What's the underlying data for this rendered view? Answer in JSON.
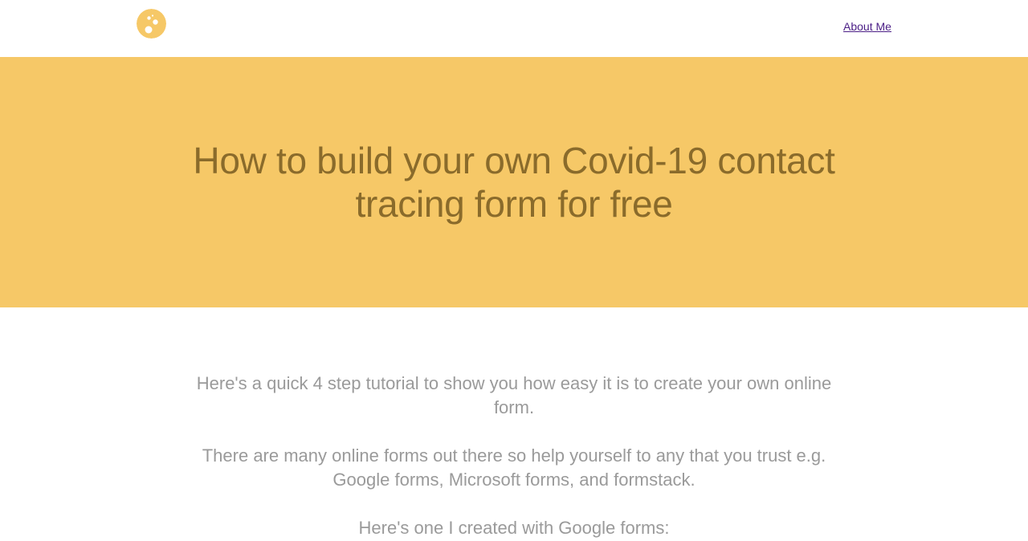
{
  "header": {
    "logo_name": "bubbles-logo",
    "nav": {
      "about_label": "About Me"
    }
  },
  "hero": {
    "title": "How to build your own Covid-19 contact tracing form for free",
    "background_color": "#f6c867",
    "title_color": "#8a6b2b"
  },
  "content": {
    "paragraphs": [
      "Here's a quick 4 step tutorial to show you how easy it is to create your own online form.",
      "There are many online forms out there so help yourself to any that you trust e.g. Google forms, Microsoft forms, and formstack.",
      "Here's one I created with Google forms:"
    ],
    "text_color": "#9a9a9a"
  }
}
